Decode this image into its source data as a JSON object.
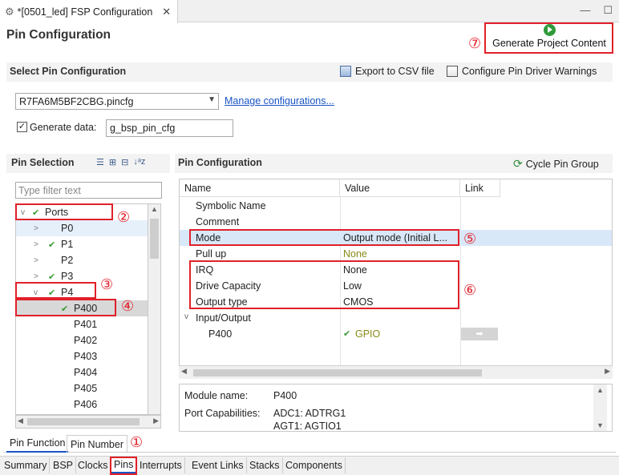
{
  "editor_tab": {
    "title": "*[0501_led] FSP Configuration",
    "close": "✕"
  },
  "window_controls": {
    "minimize": "—",
    "maximize": "☐"
  },
  "header": {
    "title": "Pin Configuration",
    "generate_button": "Generate Project Content"
  },
  "select_section": {
    "title": "Select Pin Configuration",
    "export": "Export to CSV file",
    "configure_warnings": "Configure Pin Driver Warnings",
    "config_file": "R7FA6M5BF2CBG.pincfg",
    "manage_link": "Manage configurations...",
    "generate_data_label": "Generate data:",
    "generate_data_value": "g_bsp_pin_cfg",
    "generate_data_checked": true
  },
  "pin_selection": {
    "title": "Pin Selection",
    "filter_placeholder": "Type filter text",
    "tree": [
      {
        "label": "Ports",
        "expanded": "v",
        "check": "✔"
      },
      {
        "label": "P0",
        "expanded": ">",
        "check": ""
      },
      {
        "label": "P1",
        "expanded": ">",
        "check": "✔"
      },
      {
        "label": "P2",
        "expanded": ">",
        "check": ""
      },
      {
        "label": "P3",
        "expanded": ">",
        "check": "✔"
      },
      {
        "label": "P4",
        "expanded": "v",
        "check": "✔"
      },
      {
        "label": "P400",
        "expanded": "",
        "check": "✔"
      },
      {
        "label": "P401",
        "expanded": "",
        "check": ""
      },
      {
        "label": "P402",
        "expanded": "",
        "check": ""
      },
      {
        "label": "P403",
        "expanded": "",
        "check": ""
      },
      {
        "label": "P404",
        "expanded": "",
        "check": ""
      },
      {
        "label": "P405",
        "expanded": "",
        "check": ""
      },
      {
        "label": "P406",
        "expanded": "",
        "check": ""
      }
    ]
  },
  "pin_config": {
    "title": "Pin Configuration",
    "cycle_button": "Cycle Pin Group",
    "columns": [
      "Name",
      "Value",
      "Link"
    ],
    "rows": [
      {
        "name": "Symbolic Name",
        "value": ""
      },
      {
        "name": "Comment",
        "value": ""
      },
      {
        "name": "Mode",
        "value": "Output mode (Initial L..."
      },
      {
        "name": "Pull up",
        "value": "None"
      },
      {
        "name": "IRQ",
        "value": "None"
      },
      {
        "name": "Drive Capacity",
        "value": "Low"
      },
      {
        "name": "Output type",
        "value": "CMOS"
      },
      {
        "name": "Input/Output",
        "value": ""
      },
      {
        "name": "P400",
        "value": "GPIO"
      }
    ],
    "group_toggle": "v",
    "link_arrow": "➡",
    "gpio_check": "✔"
  },
  "module_info": {
    "module_label": "Module name:",
    "module_value": "P400",
    "cap_label": "Port Capabilities:",
    "cap_values": [
      "ADC1: ADTRG1",
      "AGT1: AGTIO1"
    ]
  },
  "sub_tabs": [
    "Pin Function",
    "Pin Number"
  ],
  "bottom_tabs": [
    "Summary",
    "BSP",
    "Clocks",
    "Pins",
    "Interrupts",
    "Event Links",
    "Stacks",
    "Components"
  ],
  "annotations": [
    "①",
    "②",
    "③",
    "④",
    "⑤",
    "⑥",
    "⑦"
  ],
  "colors": {
    "annotation": "#e0202a",
    "link": "#1a55c4",
    "check": "#3a9a3a",
    "highlight": "#d9e8f8",
    "selected": "#d8d8d8",
    "olive": "#8a8a1a"
  }
}
